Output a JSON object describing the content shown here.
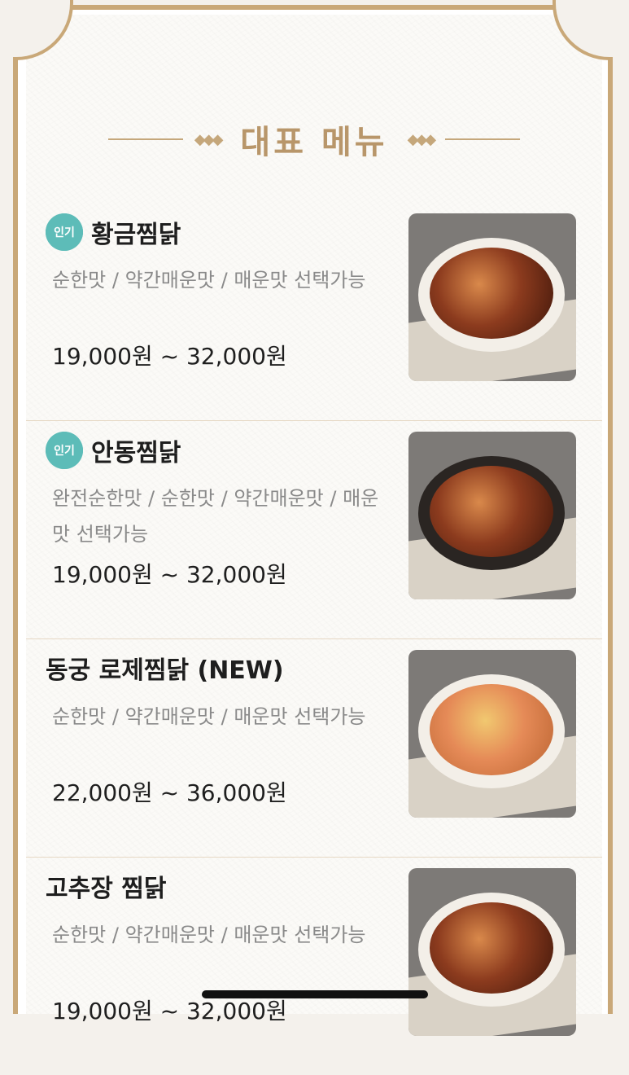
{
  "section_title": "대표 메뉴",
  "menu_items": [
    {
      "badge": "인기",
      "name": "황금찜닭",
      "desc": "순한맛 / 약간매운맛 / 매운맛 선택가능",
      "price": "19,000원 ~ 32,000원"
    },
    {
      "badge": "인기",
      "name": "안동찜닭",
      "desc": "완전순한맛 / 순한맛 / 약간매운맛 / 매운맛 선택가능",
      "price": "19,000원 ~ 32,000원"
    },
    {
      "badge": "",
      "name": "동궁 로제찜닭 (NEW)",
      "desc": "순한맛 / 약간매운맛 / 매운맛 선택가능",
      "price": "22,000원 ~ 36,000원"
    },
    {
      "badge": "",
      "name": "고추장 찜닭",
      "desc": "순한맛 / 약간매운맛 / 매운맛 선택가능",
      "price": "19,000원 ~ 32,000원"
    }
  ],
  "colors": {
    "accent": "#b8966a",
    "badge": "#5dbcb8",
    "frame": "#c9a878"
  }
}
